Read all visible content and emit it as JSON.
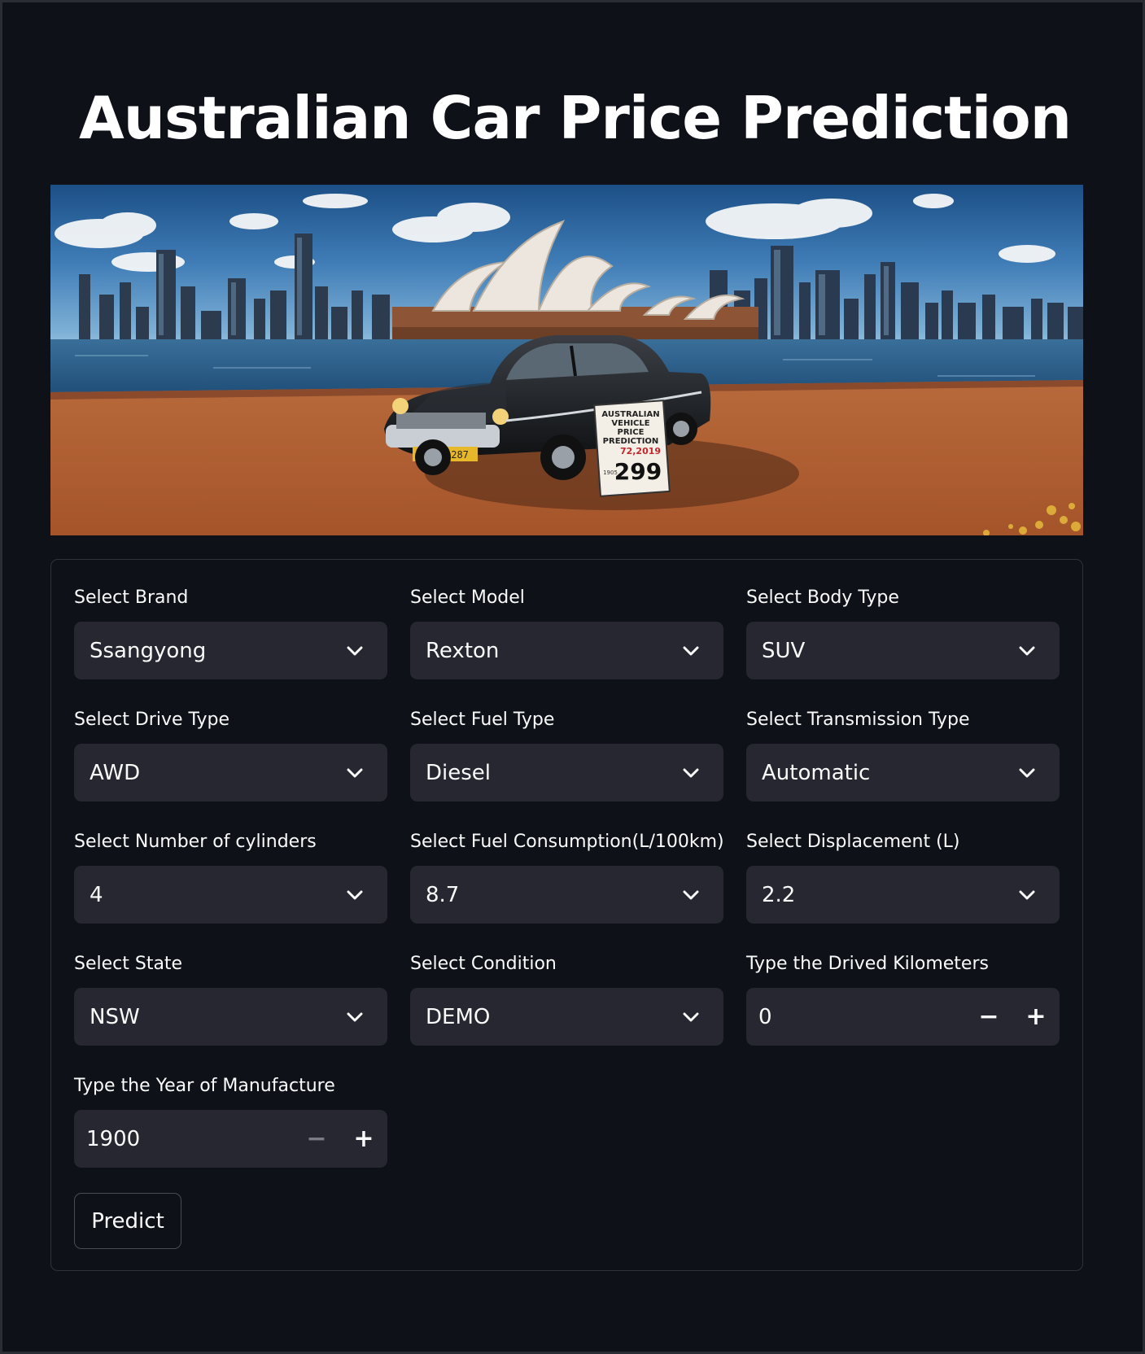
{
  "app": {
    "title": "Australian Car Price Prediction"
  },
  "banner": {
    "plate_text": "Y-09-287",
    "sign_lines": [
      "AUSTRALIAN",
      "VEHICLE",
      "PRICE",
      "PREDICTION"
    ],
    "sign_small": "72,2019",
    "sign_price": "299",
    "sign_year": "1905"
  },
  "form": {
    "brand": {
      "label": "Select Brand",
      "value": "Ssangyong"
    },
    "model": {
      "label": "Select Model",
      "value": "Rexton"
    },
    "body_type": {
      "label": "Select Body Type",
      "value": "SUV"
    },
    "drive_type": {
      "label": "Select Drive Type",
      "value": "AWD"
    },
    "fuel_type": {
      "label": "Select Fuel Type",
      "value": "Diesel"
    },
    "transmission": {
      "label": "Select Transmission Type",
      "value": "Automatic"
    },
    "cylinders": {
      "label": "Select Number of cylinders",
      "value": "4"
    },
    "fuel_consumption": {
      "label": "Select Fuel Consumption(L/100km)",
      "value": "8.7"
    },
    "displacement": {
      "label": "Select Displacement (L)",
      "value": "2.2"
    },
    "state": {
      "label": "Select State",
      "value": "NSW"
    },
    "condition": {
      "label": "Select Condition",
      "value": "DEMO"
    },
    "kilometers": {
      "label": "Type the Drived Kilometers",
      "value": "0",
      "minus": "−",
      "plus": "+"
    },
    "year": {
      "label": "Type the Year of Manufacture",
      "value": "1900",
      "minus": "−",
      "plus": "+"
    },
    "predict_label": "Predict"
  },
  "icons": {
    "dropdown": "chevron-down-icon"
  },
  "colors": {
    "background": "#0e1117",
    "input_bg": "#262730",
    "text": "#fafafa",
    "border": "#31333b"
  }
}
